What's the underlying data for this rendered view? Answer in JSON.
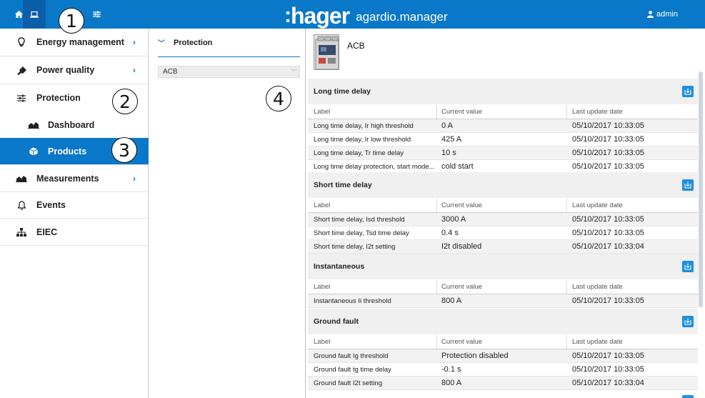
{
  "header": {
    "logo_colon": ":",
    "logo_brand": "hager",
    "product_name": "agardio.manager",
    "user": "admin",
    "icons": [
      "home-icon",
      "laptop-icon",
      "sliders-icon",
      "user-icon"
    ]
  },
  "callouts": [
    "1",
    "2",
    "3",
    "4"
  ],
  "sidebar": {
    "items": [
      {
        "label": "Energy management",
        "icon": "lightbulb-icon",
        "chevron": "›"
      },
      {
        "label": "Power quality",
        "icon": "plug-icon",
        "chevron": "›"
      },
      {
        "label": "Protection",
        "icon": "sliders-icon"
      },
      {
        "label": "Dashboard",
        "icon": "area-chart-icon"
      },
      {
        "label": "Products",
        "icon": "cube-icon"
      },
      {
        "label": "Measurements",
        "icon": "area-chart-icon",
        "chevron": "›"
      },
      {
        "label": "Events",
        "icon": "bell-icon"
      },
      {
        "label": "EIEC",
        "icon": "sitemap-icon"
      }
    ]
  },
  "middle": {
    "header": "Protection",
    "select_value": "ACB"
  },
  "main": {
    "product_title": "ACB",
    "columns": [
      "Label",
      "Current value",
      "Last update date"
    ],
    "sections": [
      {
        "title": "Long time delay",
        "rows": [
          [
            "Long time delay, Ir high threshold",
            "0 A",
            "05/10/2017 10:33:05"
          ],
          [
            "Long time delay, Ir low threshold",
            "425 A",
            "05/10/2017 10:33:05"
          ],
          [
            "Long time delay, Tr time delay",
            "10 s",
            "05/10/2017 10:33:05"
          ],
          [
            "Long time delay protection, start mode...",
            "cold start",
            "05/10/2017 10:33:05"
          ]
        ]
      },
      {
        "title": "Short time delay",
        "rows": [
          [
            "Short time delay, Isd threshold",
            "3000 A",
            "05/10/2017 10:33:05"
          ],
          [
            "Short time delay, Tsd time delay",
            "0.4 s",
            "05/10/2017 10:33:05"
          ],
          [
            "Short time delay, I2t setting",
            "I2t disabled",
            "05/10/2017 10:33:04"
          ]
        ]
      },
      {
        "title": "Instantaneous",
        "rows": [
          [
            "Instantaneous Ii threshold",
            "800 A",
            "05/10/2017 10:33:05"
          ]
        ]
      },
      {
        "title": "Ground fault",
        "rows": [
          [
            "Ground fault Ig threshold",
            "Protection disabled",
            "05/10/2017 10:33:05"
          ],
          [
            "Ground fault tg time delay",
            "-0.1 s",
            "05/10/2017 10:33:05"
          ],
          [
            "Ground fault I2t setting",
            "800 A",
            "05/10/2017 10:33:04"
          ]
        ]
      }
    ]
  },
  "colors": {
    "accent": "#0a78c8",
    "header_bg": "#0a78c8",
    "selected": "#0a78c8",
    "export_button": "#1e8fe0"
  }
}
